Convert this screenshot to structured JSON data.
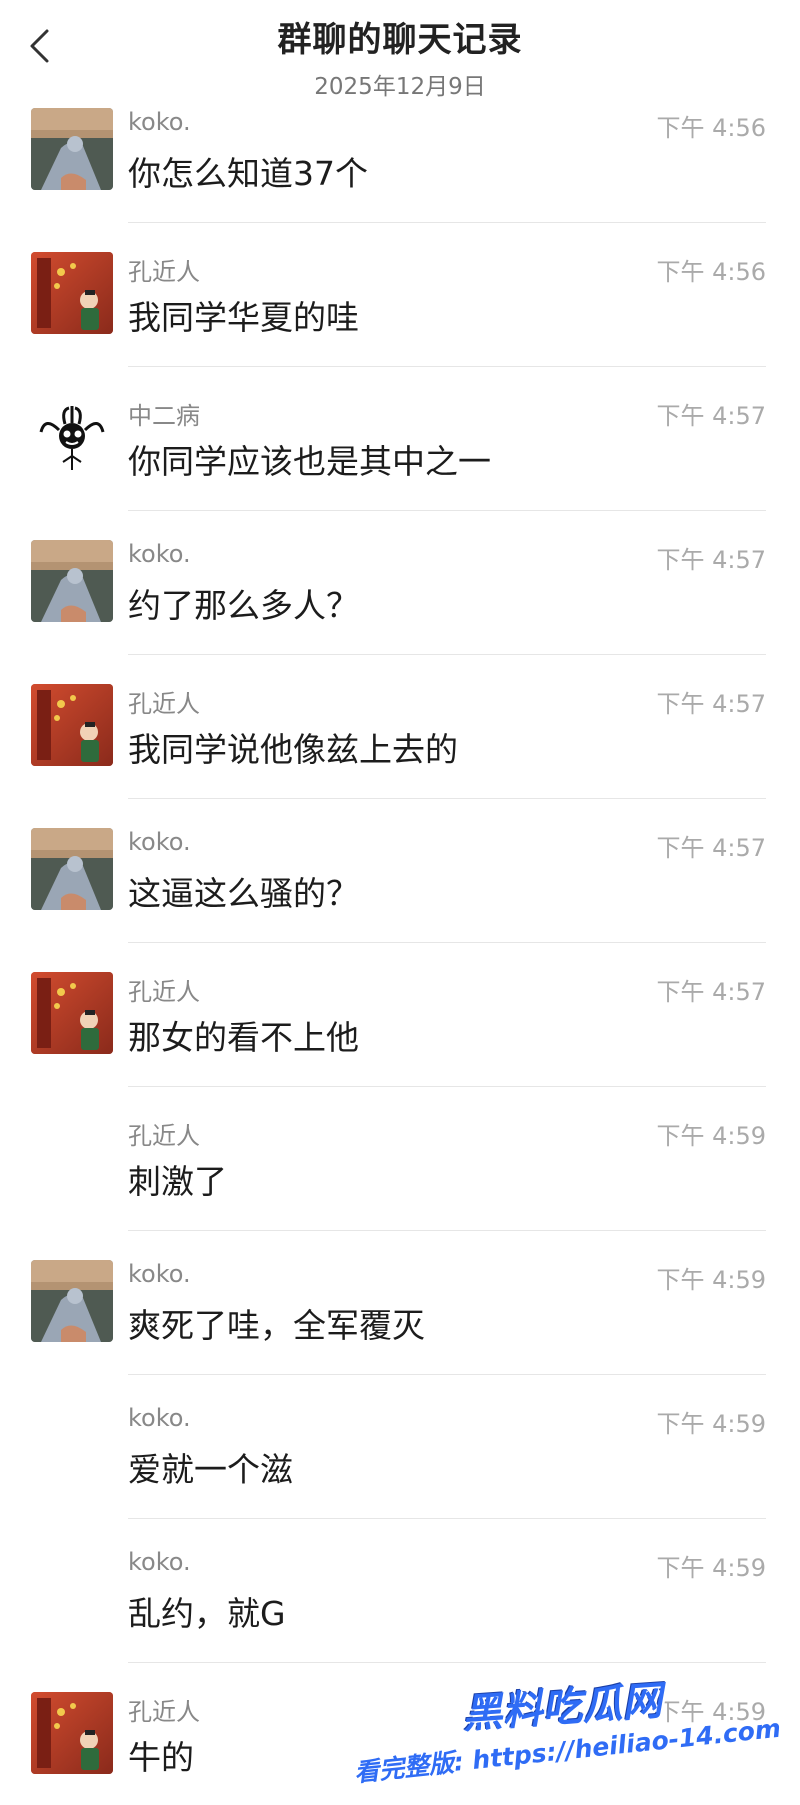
{
  "header": {
    "title": "群聊的聊天记录",
    "date": "2025年12月9日"
  },
  "messages": [
    {
      "sender": "koko.",
      "time": "下午 4:56",
      "text": "你怎么知道37个",
      "avatar": "koko"
    },
    {
      "sender": "孔近人",
      "time": "下午 4:56",
      "text": "我同学华夏的哇",
      "avatar": "kong"
    },
    {
      "sender": "中二病",
      "time": "下午 4:57",
      "text": "你同学应该也是其中之一",
      "avatar": "zhong"
    },
    {
      "sender": "koko.",
      "time": "下午 4:57",
      "text": "约了那么多人？",
      "avatar": "koko"
    },
    {
      "sender": "孔近人",
      "time": "下午 4:57",
      "text": "我同学说他像兹上去的",
      "avatar": "kong"
    },
    {
      "sender": "koko.",
      "time": "下午 4:57",
      "text": "这逼这么骚的？",
      "avatar": "koko"
    },
    {
      "sender": "孔近人",
      "time": "下午 4:57",
      "text": "那女的看不上他",
      "avatar": "kong"
    },
    {
      "sender": "孔近人",
      "time": "下午 4:59",
      "text": "刺激了",
      "avatar": ""
    },
    {
      "sender": "koko.",
      "time": "下午 4:59",
      "text": "爽死了哇，全军覆灭",
      "avatar": "koko"
    },
    {
      "sender": "koko.",
      "time": "下午 4:59",
      "text": "爱就一个滋",
      "avatar": ""
    },
    {
      "sender": "koko.",
      "time": "下午 4:59",
      "text": "乱约，就G",
      "avatar": ""
    },
    {
      "sender": "孔近人",
      "time": "下午 4:59",
      "text": "牛的",
      "avatar": "kong"
    }
  ],
  "watermark": {
    "title": "黑料吃瓜网",
    "subtitle": "看完整版: https://heiliao-14.com"
  },
  "colors": {
    "watermark": "#2f6cf5",
    "divider": "#e6e6e6"
  },
  "icons": {
    "back": "chevron-left-icon"
  }
}
